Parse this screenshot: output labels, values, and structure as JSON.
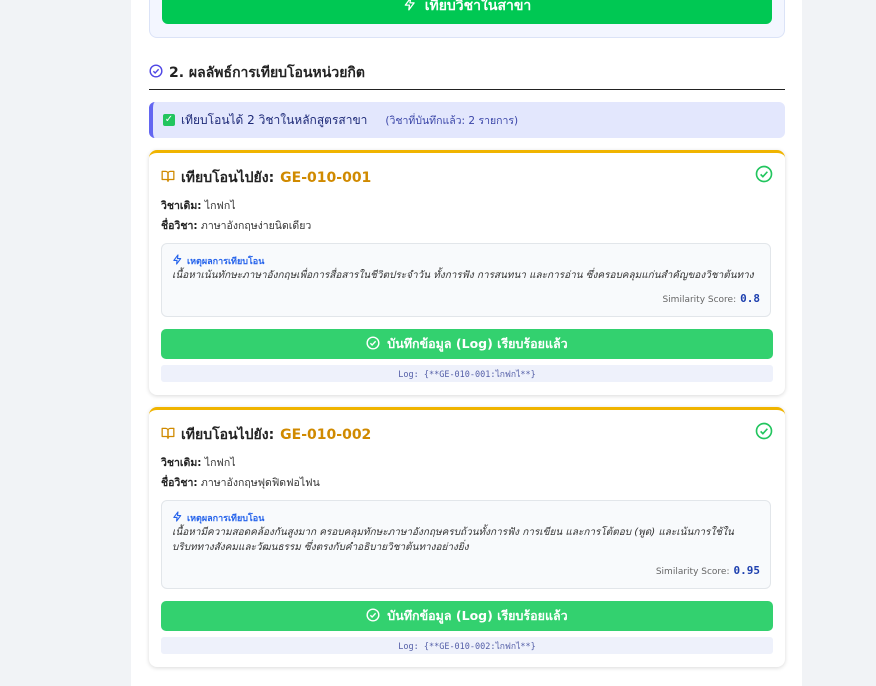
{
  "top_action": {
    "label": "เทียบวิชาในสาขา"
  },
  "section": {
    "title": "2. ผลลัพธ์การเทียบโอนหน่วยกิต"
  },
  "summary": {
    "text": "เทียบโอนได้ 2 วิชาในหลักสูตรสาขา",
    "note": "(วิชาที่บันทึกแล้ว: 2 รายการ)"
  },
  "results": [
    {
      "title_prefix": "เทียบโอนไปยัง:",
      "code": "GE-010-001",
      "original_label": "วิชาเดิม:",
      "original_value": "ไกฟกไ",
      "name_label": "ชื่อวิชา:",
      "name_value": "ภาษาอังกฤษง่ายนิดเดียว",
      "reason_label": "เหตุผลการเทียบโอน",
      "reason_text": "เนื้อหาเน้นทักษะภาษาอังกฤษเพื่อการสื่อสารในชีวิตประจำวัน ทั้งการฟัง การสนทนา และการอ่าน ซึ่งครอบคลุมแก่นสำคัญของวิชาต้นทาง",
      "score_label": "Similarity Score:",
      "score_value": "0.8",
      "button_label": "บันทึกข้อมูล (Log) เรียบร้อยแล้ว",
      "log_text": "Log: {**GE-010-001:ไกฟกไ**}"
    },
    {
      "title_prefix": "เทียบโอนไปยัง:",
      "code": "GE-010-002",
      "original_label": "วิชาเดิม:",
      "original_value": "ไกฟกไ",
      "name_label": "ชื่อวิชา:",
      "name_value": "ภาษาอังกฤษฟุดฟิดฟอไฟน",
      "reason_label": "เหตุผลการเทียบโอน",
      "reason_text": "เนื้อหามีความสอดคล้องกันสูงมาก ครอบคลุมทักษะภาษาอังกฤษครบถ้วนทั้งการฟัง การเขียน และการโต้ตอบ (พูด) และเน้นการใช้ในบริบททางสังคมและวัฒนธรรม ซึ่งตรงกับคำอธิบายวิชาต้นทางอย่างยิ่ง",
      "score_label": "Similarity Score:",
      "score_value": "0.95",
      "button_label": "บันทึกข้อมูล (Log) เรียบร้อยแล้ว",
      "log_text": "Log: {**GE-010-002:ไกฟกไ**}"
    }
  ],
  "colors": {
    "accent_green": "#00c853",
    "log_button_green": "#33d16f",
    "card_border": "#f0b400",
    "code_color": "#d08a00",
    "summary_bg": "#e3e7fd"
  },
  "icons": {
    "top_action": "bolt-icon",
    "section": "check-circle-icon",
    "card_title": "book-open-icon",
    "card_status": "check-circle-icon",
    "reason": "bolt-icon",
    "log_button": "check-circle-icon"
  }
}
